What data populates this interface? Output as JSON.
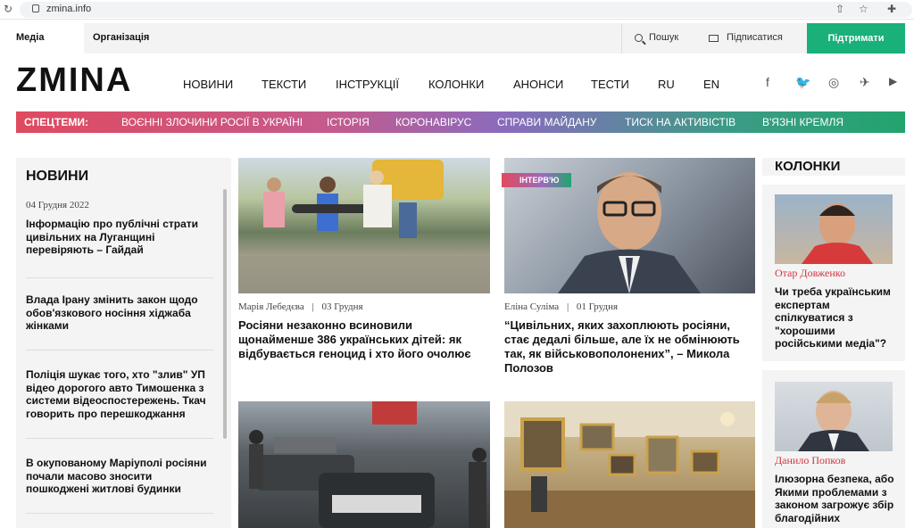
{
  "browser": {
    "url": "zmina.info"
  },
  "topbar": {
    "tabs": [
      "Медіа",
      "Організація"
    ],
    "search_label": "Пошук",
    "subscribe_label": "Підписатися",
    "support_label": "Підтримати"
  },
  "header": {
    "logo": "ZMINA",
    "nav": [
      "НОВИНИ",
      "ТЕКСТИ",
      "ІНСТРУКЦІЇ",
      "КОЛОНКИ",
      "АНОНСИ",
      "ТЕСТИ",
      "RU",
      "EN"
    ],
    "social": [
      "facebook-icon",
      "twitter-icon",
      "instagram-icon",
      "telegram-icon",
      "youtube-icon"
    ]
  },
  "specbar": {
    "title": "СПЕЦТЕМИ:",
    "items": [
      "ВОЄННІ ЗЛОЧИНИ РОСІЇ В УКРАЇНІ",
      "ІСТОРІЯ",
      "КОРОНАВІРУС",
      "СПРАВИ МАЙДАНУ",
      "ТИСК НА АКТИВІСТІВ",
      "В'ЯЗНІ КРЕМЛЯ"
    ]
  },
  "news": {
    "title": "НОВИНИ",
    "date": "04 Грудня 2022",
    "items": [
      "Інформацію про публічні страти цивільних на Луганщині перевіряють – Гайдай",
      "Влада Ірану змінить закон щодо обов'язкового носіння хіджаба жінками",
      "Поліція шукає того, хто \"злив\" УП відео дорогого авто Тимошенка з системи відеоспостережень. Ткач говорить про перешкоджання",
      "В окупованому Маріуполі росіяни почали масово зносити пошкоджені житлові будинки"
    ]
  },
  "cards": [
    {
      "author": "Марія Лебедєва",
      "date": "03 Грудня",
      "title": "Росіяни незаконно всиновили щонайменше 386 українських дітей: як відбувається геноцид і хто його очолює"
    },
    {
      "badge": "ІНТЕРВ'Ю",
      "author": "Еліна Суліма",
      "date": "01 Грудня",
      "title": "“Цивільних, яких захоплюють росіяни, стає дедалі більше, але їх не обмінюють так, як військовополонених”, – Микола Полозов"
    }
  ],
  "columns": {
    "title": "КОЛОНКИ",
    "items": [
      {
        "author": "Отар Довженко",
        "title": "Чи треба українським експертам спілкуватися з \"хорошими російськими медіа\"?"
      },
      {
        "author": "Данило Попков",
        "title": "Ілюзорна безпека, або Якими проблемами з законом загрожує збір благодійних"
      }
    ]
  },
  "colors": {
    "accent_green": "#1ab07a",
    "author_red": "#d2343f"
  }
}
